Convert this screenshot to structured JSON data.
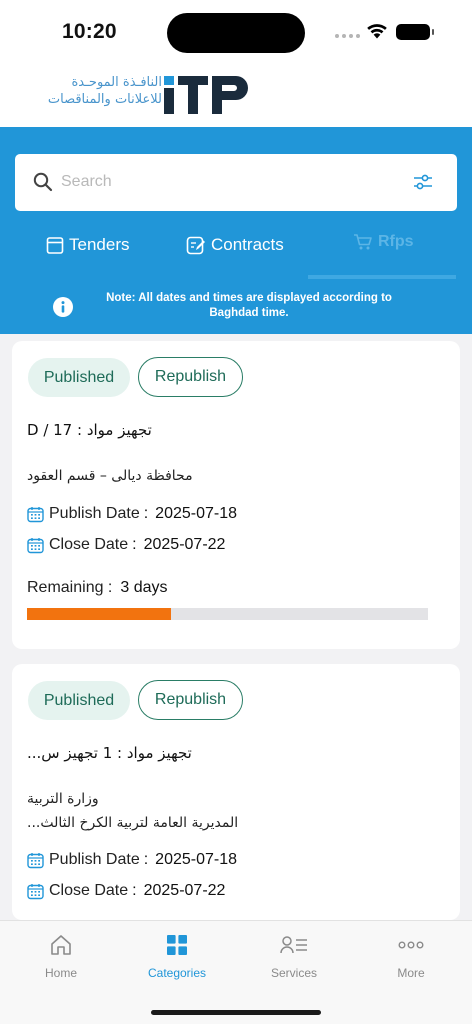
{
  "status_bar": {
    "time": "10:20"
  },
  "brand": {
    "arabic_line1": "النافـذة الموحـدة",
    "arabic_line2": "للاعلانات والمناقصات",
    "logo_text": "ITP",
    "accent": "#2196d8",
    "dark": "#1a2b3c"
  },
  "search": {
    "placeholder": "Search",
    "icon": "search-icon",
    "filter_icon": "filter-sliders-icon"
  },
  "tabs": [
    {
      "label": "Tenders",
      "icon": "box-icon",
      "active": false
    },
    {
      "label": "Contracts",
      "icon": "contract-edit-icon",
      "active": false
    },
    {
      "label": "Rfps",
      "icon": "cart-icon",
      "active": true
    }
  ],
  "note": {
    "text": "Note: All dates and times are displayed according to Baghdad time."
  },
  "cards": [
    {
      "status": "Published",
      "action": "Republish",
      "title": "تجهيز مواد : D / 17",
      "org_line1": "محافظة ديالى – قسم العقود",
      "org_line2": "",
      "publish_label": "Publish Date",
      "publish_date": "2025-07-18",
      "close_label": "Close Date",
      "close_date": "2025-07-22",
      "remaining_label": "Remaining :",
      "remaining_value": "3 days",
      "progress": 0.36,
      "progress_color": "#f2730f"
    },
    {
      "status": "Published",
      "action": "Republish",
      "title": "تجهيز مواد : 1 تجهيز س...",
      "org_line1": "وزارة التربية",
      "org_line2": "المديرية العامة لتربية الكرخ الثالث...",
      "publish_label": "Publish Date",
      "publish_date": "2025-07-18",
      "close_label": "Close Date",
      "close_date": "2025-07-22"
    }
  ],
  "bottom_nav": [
    {
      "label": "Home",
      "icon": "home-icon",
      "active": false
    },
    {
      "label": "Categories",
      "icon": "grid-icon",
      "active": true
    },
    {
      "label": "Services",
      "icon": "user-list-icon",
      "active": false
    },
    {
      "label": "More",
      "icon": "more-dots-icon",
      "active": false
    }
  ]
}
